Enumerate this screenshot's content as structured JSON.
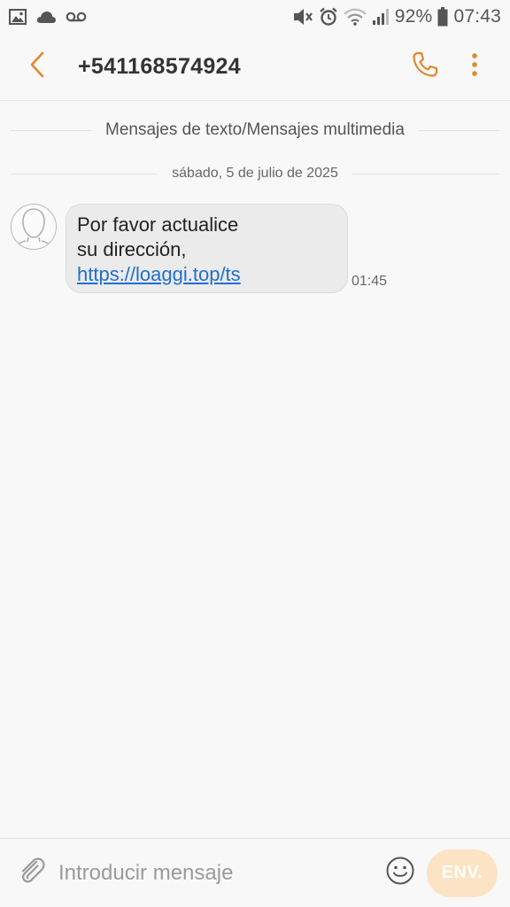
{
  "colors": {
    "accent": "#e3872d",
    "background": "#f8f8f8",
    "bubble": "#ebebeb",
    "link": "#1f6fd1",
    "send_button": "#fbe3c4"
  },
  "status_bar": {
    "icons_left": [
      "image-icon",
      "cloud-icon",
      "voicemail-icon"
    ],
    "icons_right": [
      "mute-icon",
      "alarm-icon",
      "wifi-icon",
      "signal-icon",
      "battery-icon"
    ],
    "battery": "92%",
    "time": "07:43"
  },
  "header": {
    "title": "+541168574924",
    "icons": [
      "back-icon",
      "phone-icon",
      "more-vert-icon"
    ]
  },
  "thread": {
    "type_label": "Mensajes de texto/Mensajes multimedia",
    "date_label": "sábado, 5 de julio de 2025",
    "messages": [
      {
        "line1": "Por favor actualice",
        "line2": "su dirección,",
        "link": "https://loaggi.top/ts",
        "time": "01:45"
      }
    ]
  },
  "composer": {
    "placeholder": "Introducir mensaje",
    "value": "",
    "send_label": "ENV.",
    "icons": [
      "attach-icon",
      "emoji-icon"
    ]
  }
}
